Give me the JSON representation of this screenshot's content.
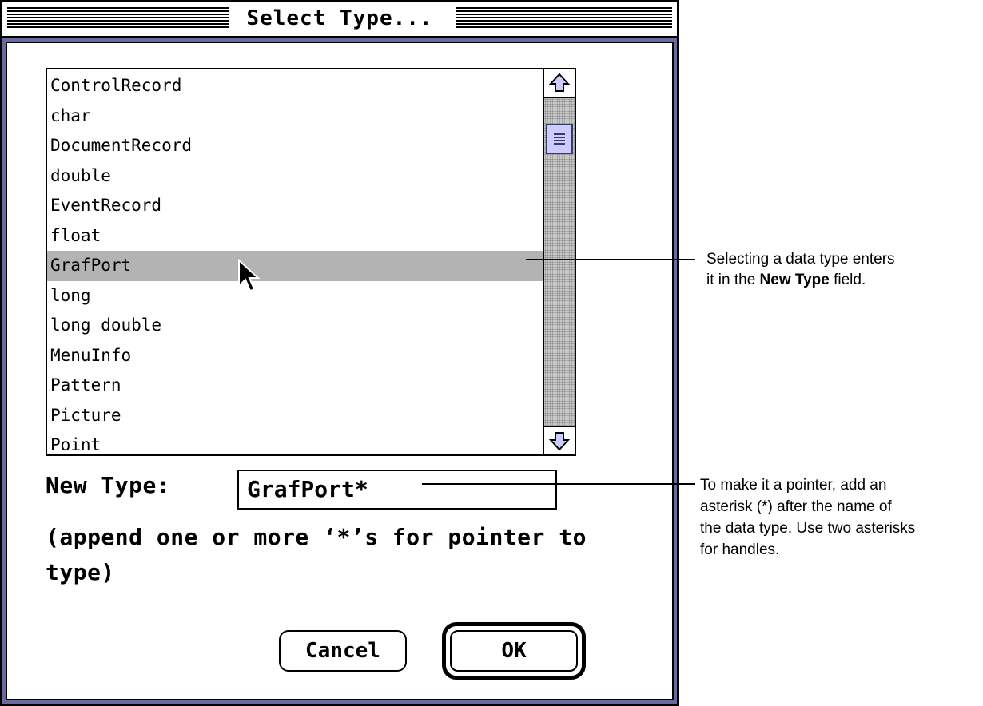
{
  "dialog": {
    "title": "Select Type...",
    "list_items": [
      "ControlRecord",
      "char",
      "DocumentRecord",
      "double",
      "EventRecord",
      "float",
      "GrafPort",
      "long",
      "long double",
      "MenuInfo",
      "Pattern",
      "Picture",
      "Point"
    ],
    "selected_item": "GrafPort",
    "new_type_label": "New Type:",
    "new_type_value": "GrafPort*",
    "hint_text": "(append one or more ‘*’s for pointer to type)",
    "cancel_label": "Cancel",
    "ok_label": "OK"
  },
  "annotations": {
    "selection_callout": {
      "line1": "Selecting a data type enters",
      "line2_prefix": "it in the ",
      "line2_bold": "New Type",
      "line2_suffix": " field."
    },
    "pointer_callout": {
      "lines": [
        "To make it a pointer, add an",
        "asterisk (*) after the name of",
        "the data type. Use two asterisks",
        "for handles."
      ]
    }
  },
  "colors": {
    "selection_highlight": "#b3b3b3",
    "scroll_thumb": "#ccccff",
    "window_frame_accent": "#6a6a9c"
  },
  "icons": [
    "up-arrow-icon",
    "down-arrow-icon",
    "scroll-thumb-grip-icon",
    "mouse-pointer-icon"
  ]
}
